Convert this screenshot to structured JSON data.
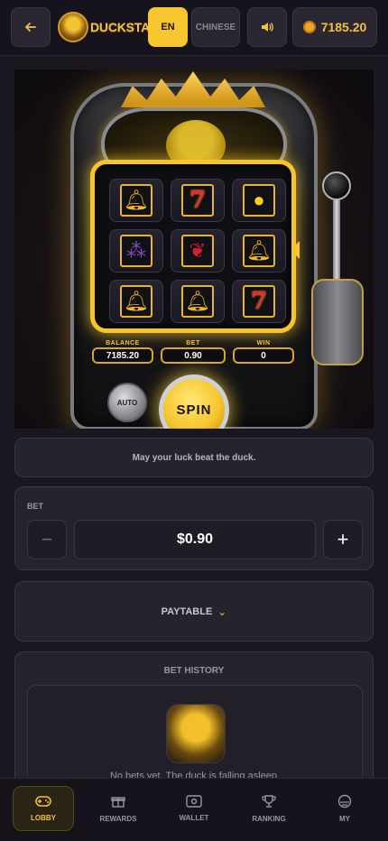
{
  "header": {
    "back_icon": "arrow-left-icon",
    "brand": "DUCKSTAKE",
    "lang_en": "EN",
    "lang_cn": "CHINESE",
    "sound_icon": "speaker-icon",
    "balance": "7185.20",
    "accent": "#f8c62f"
  },
  "machine": {
    "symbols": [
      [
        "bell",
        "seven",
        "lemon"
      ],
      [
        "grape",
        "cherry",
        "bell"
      ],
      [
        "bell",
        "bell",
        "seven"
      ]
    ],
    "balance_label": "BALANCE",
    "balance_value": "7185.20",
    "bet_label": "BET",
    "bet_value": "0.90",
    "win_label": "WIN",
    "win_value": "0",
    "auto_label": "AUTO",
    "spin_label": "SPIN"
  },
  "tagline": "May your luck beat the duck.",
  "bet": {
    "label": "BET",
    "value": "$0.90",
    "minus": "−",
    "plus": "+"
  },
  "paytable": {
    "label": "PAYTABLE",
    "chevron": "⌄"
  },
  "history": {
    "title": "BET HISTORY",
    "empty": "No bets yet. The duck is falling asleep."
  },
  "nav": {
    "items": [
      {
        "label": "LOBBY",
        "icon": "gamepad-icon",
        "active": true
      },
      {
        "label": "REWARDS",
        "icon": "gift-icon",
        "active": false
      },
      {
        "label": "WALLET",
        "icon": "wallet-icon",
        "active": false
      },
      {
        "label": "RANKING",
        "icon": "trophy-icon",
        "active": false
      },
      {
        "label": "MY",
        "icon": "user-icon",
        "active": false
      }
    ]
  }
}
